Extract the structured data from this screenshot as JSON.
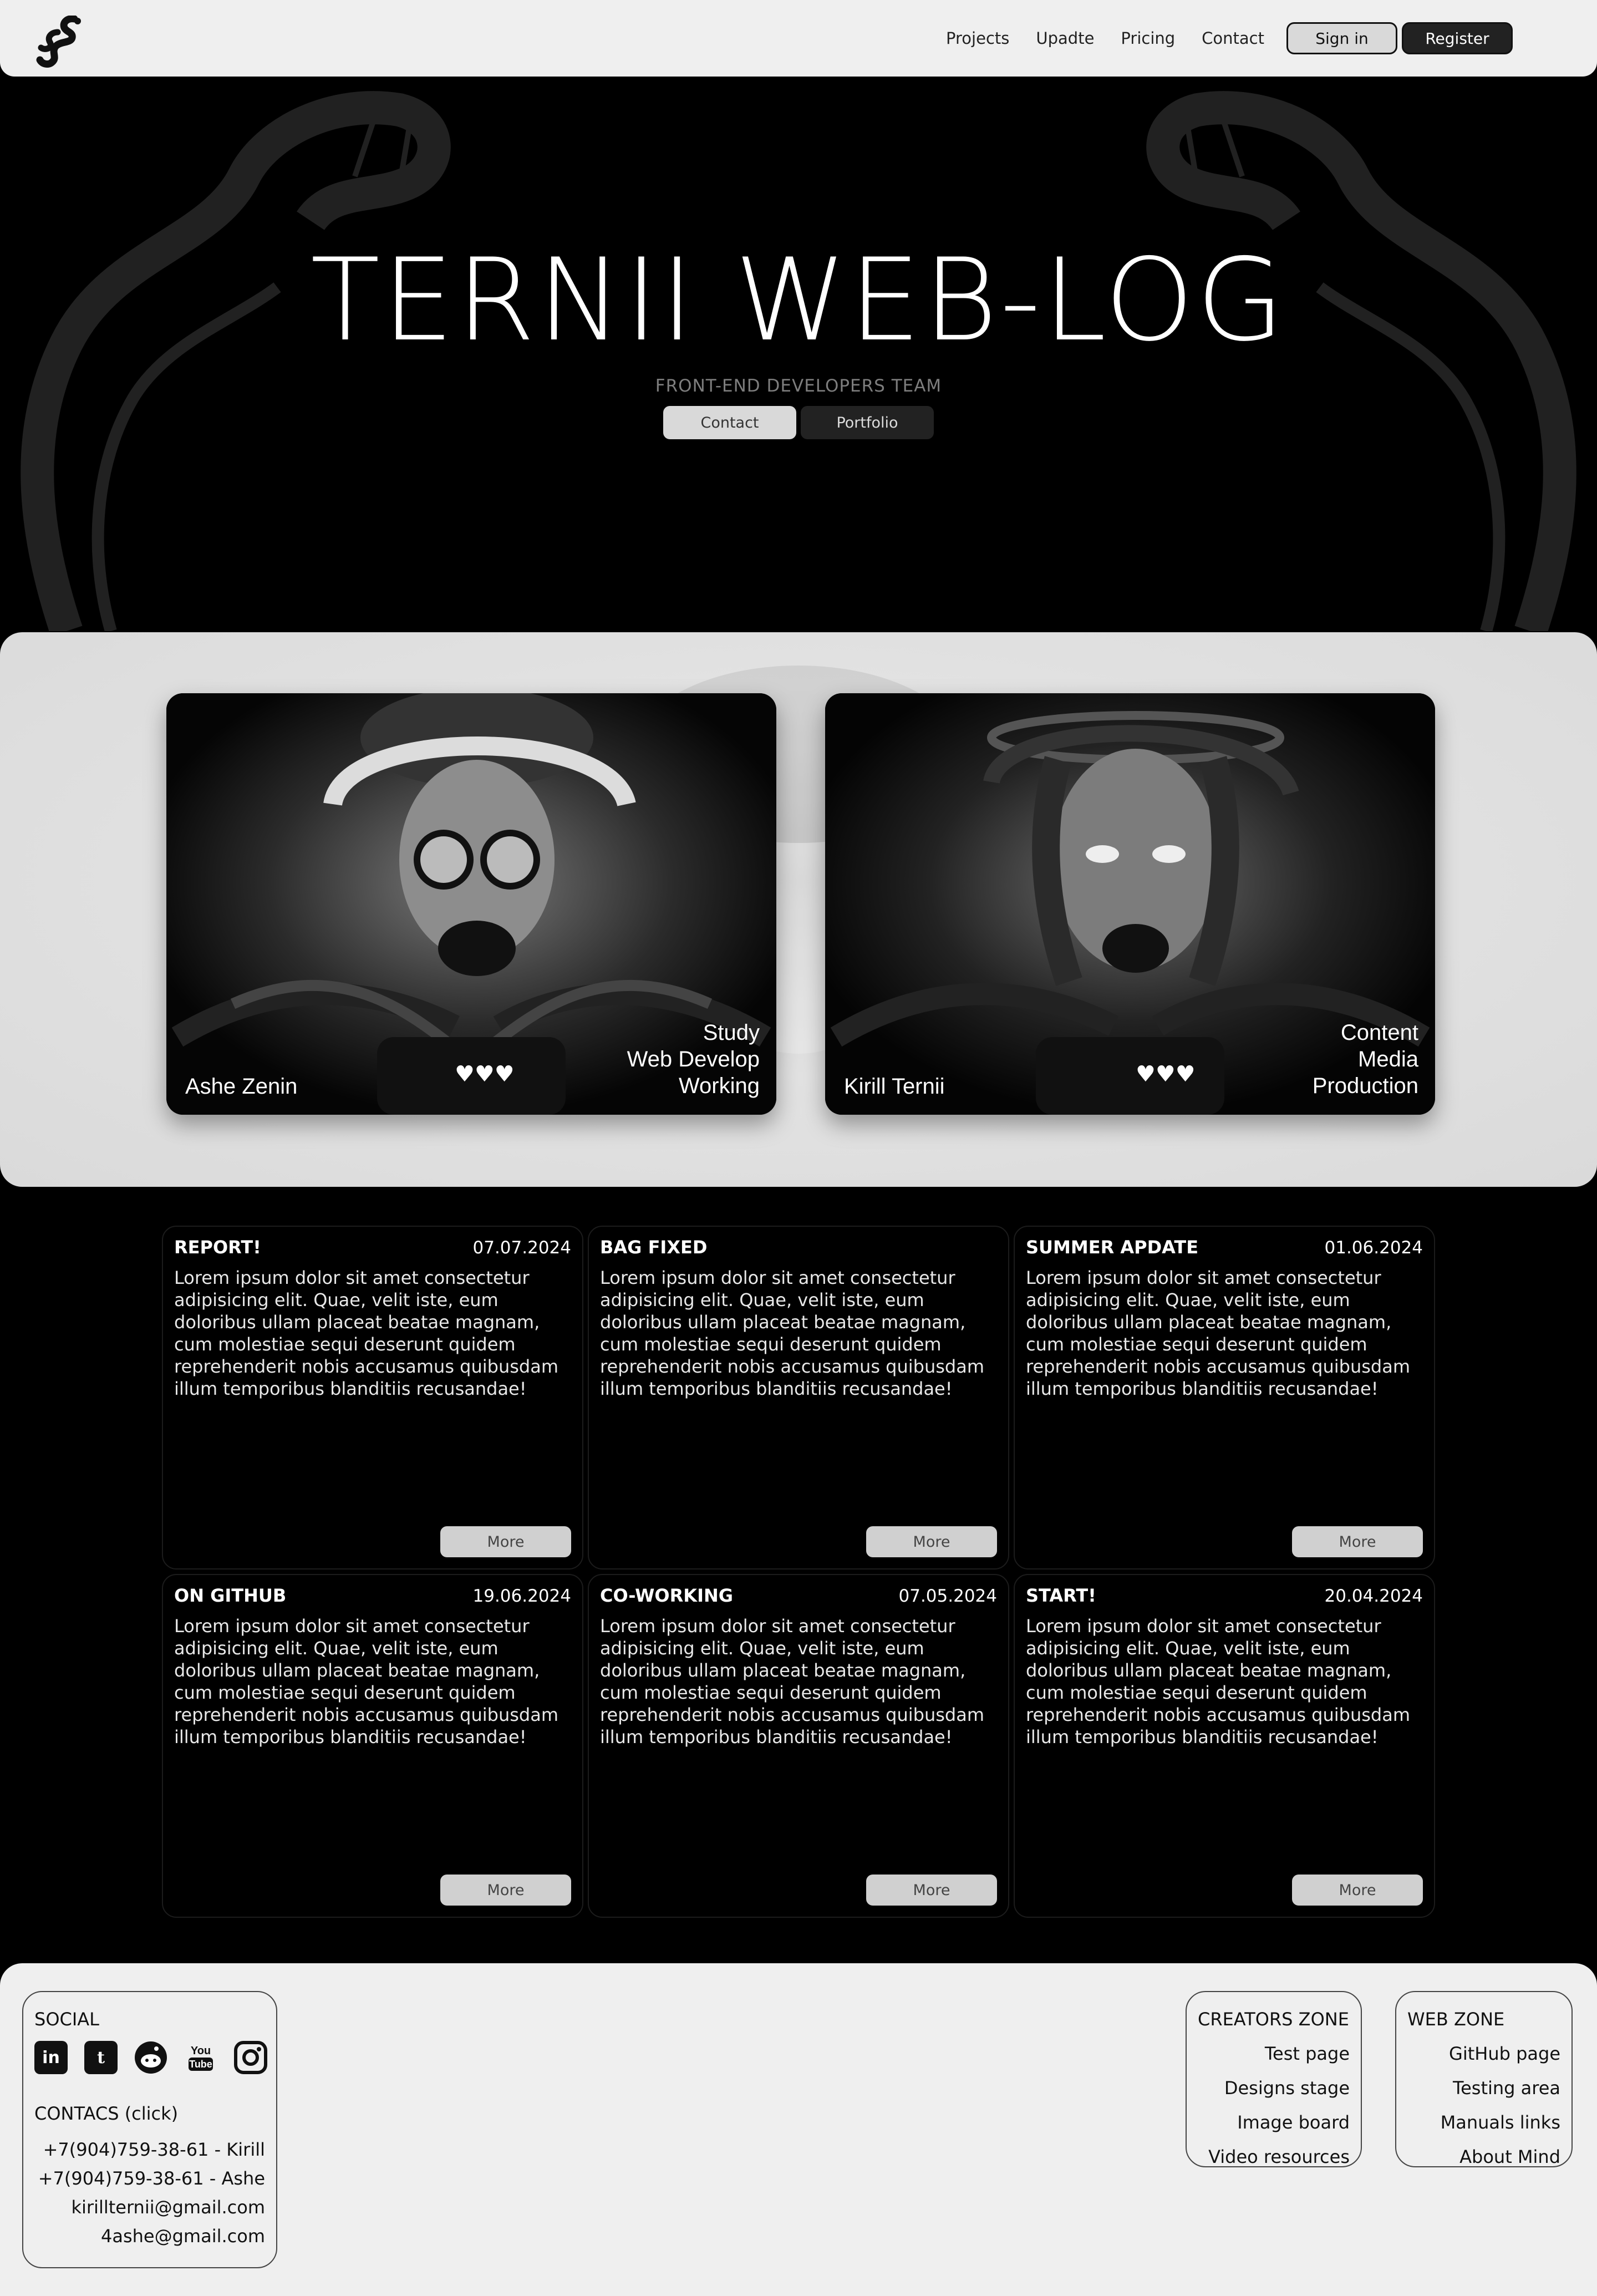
{
  "header": {
    "logo_icon": "snake-logo-icon",
    "nav": [
      "Projects",
      "Upadte",
      "Pricing",
      "Contact"
    ],
    "sign_in": "Sign in",
    "register": "Register"
  },
  "hero": {
    "title": "TERNII WEB-LOG",
    "subtitle": "FRONT-END DEVELOPERS TEAM",
    "contact_button": "Contact",
    "portfolio_button": "Portfolio"
  },
  "team": {
    "members": [
      {
        "name": "Ashe Zenin",
        "roles": [
          "Study",
          "Web Develop",
          "Working"
        ]
      },
      {
        "name": "Kirill Ternii",
        "roles": [
          "Content",
          "Media",
          "Production"
        ]
      }
    ]
  },
  "news": {
    "more_label": "More",
    "items": [
      {
        "title": "REPORT!",
        "date": "07.07.2024",
        "body": "Lorem ipsum dolor sit amet consectetur adipisicing elit. Quae, velit iste, eum doloribus ullam placeat beatae magnam, cum molestiae sequi deserunt quidem reprehenderit nobis accusamus quibusdam illum temporibus blanditiis recusandae!"
      },
      {
        "title": "BAG FIXED",
        "date": "",
        "body": "Lorem ipsum dolor sit amet consectetur adipisicing elit. Quae, velit iste, eum doloribus ullam placeat beatae magnam, cum molestiae sequi deserunt quidem reprehenderit nobis accusamus quibusdam illum temporibus blanditiis recusandae!"
      },
      {
        "title": "SUMMER APDATE",
        "date": "01.06.2024",
        "body": "Lorem ipsum dolor sit amet consectetur adipisicing elit. Quae, velit iste, eum doloribus ullam placeat beatae magnam, cum molestiae sequi deserunt quidem reprehenderit nobis accusamus quibusdam illum temporibus blanditiis recusandae!"
      },
      {
        "title": "ON GITHUB",
        "date": "19.06.2024",
        "body": "Lorem ipsum dolor sit amet consectetur adipisicing elit. Quae, velit iste, eum doloribus ullam placeat beatae magnam, cum molestiae sequi deserunt quidem reprehenderit nobis accusamus quibusdam illum temporibus blanditiis recusandae!"
      },
      {
        "title": "CO-WORKING",
        "date": "07.05.2024",
        "body": "Lorem ipsum dolor sit amet consectetur adipisicing elit. Quae, velit iste, eum doloribus ullam placeat beatae magnam, cum molestiae sequi deserunt quidem reprehenderit nobis accusamus quibusdam illum temporibus blanditiis recusandae!"
      },
      {
        "title": "START!",
        "date": "20.04.2024",
        "body": "Lorem ipsum dolor sit amet consectetur adipisicing elit. Quae, velit iste, eum doloribus ullam placeat beatae magnam, cum molestiae sequi deserunt quidem reprehenderit nobis accusamus quibusdam illum temporibus blanditiis recusandae!"
      }
    ]
  },
  "footer": {
    "social": {
      "title": "SOCIAL",
      "icons": [
        "linkedin-icon",
        "tumblr-icon",
        "reddit-icon",
        "youtube-icon",
        "instagram-icon"
      ],
      "contacts_title": "CONTACS (click)",
      "contacts": [
        "+7(904)759-38-61 - Kirill",
        "+7(904)759-38-61 - Ashe",
        "kirillternii@gmail.com",
        "4ashe@gmail.com"
      ]
    },
    "creators": {
      "title": "CREATORS ZONE",
      "links": [
        "Test page",
        "Designs stage",
        "Image board",
        "Video resources"
      ]
    },
    "web": {
      "title": "WEB ZONE",
      "links": [
        "GitHub page",
        "Testing area",
        "Manuals links",
        "About Mind"
      ]
    }
  }
}
